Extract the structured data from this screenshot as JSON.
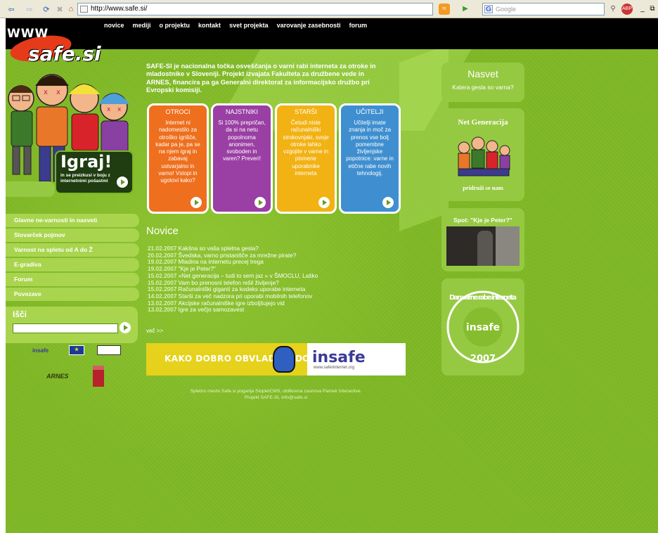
{
  "browser": {
    "url": "http://www.safe.si/",
    "search_placeholder": "Google",
    "search_engine_icon": "G"
  },
  "logo": {
    "www": "WWW",
    "safe": "safe.si"
  },
  "topnav": [
    "novice",
    "mediji",
    "o projektu",
    "kontakt",
    "svet projekta",
    "varovanje zasebnosti",
    "forum"
  ],
  "intro": "SAFE-SI je nacionalna točka osveščanja o varni rabi interneta za otroke in mladostnike v Sloveniji. Projekt izvajata Fakulteta za družbene vede in ARNES, financira pa ga Generalni direktorat za informacijsko družbo pri Evropski komisiji.",
  "cards": [
    {
      "title": "OTROCI",
      "text": "Internet ni nadomestilo za otroško igrišče, kadar pa je, pa se na njem igraj in zabavaj ustvarjalno in varno! Vstopi in ugotovi kako?",
      "color": "#ee6f1d"
    },
    {
      "title": "NAJSTNIKI",
      "text": "Si 100% prepričan, da si na netu popolnoma anonimen, svoboden in varen? Preveri!",
      "color": "#9a3fa3"
    },
    {
      "title": "STARŠI",
      "text": "Četudi niste računalniški strokovnjaki, svoje otroke lahko vzgojite v varne in pismene uporabnike interneta",
      "color": "#f2b214"
    },
    {
      "title": "UČITELJI",
      "text": "Učitelji imate znanja in moč za prenos vse bolj pomembne življenjske popotnice: varne in etične rabe novih tehnologij.",
      "color": "#3f8fd0"
    }
  ],
  "igraj": {
    "title": "Igraj!",
    "subtitle": "in se preizkusi v boju z internetnimi pošastmi"
  },
  "sidebar_menu": [
    "Glavne ne-varnosti in nasveti",
    "Slovarček pojmov",
    "Varnost na spletu od A do Ž",
    "E-gradiva",
    "Forum",
    "Povezave"
  ],
  "search": {
    "label": "Išči",
    "value": ""
  },
  "partners": {
    "insafe": "insafe",
    "eu": "EU",
    "arnes": "ARNES"
  },
  "news": {
    "title": "Novice",
    "items": [
      {
        "date": "21.02.2007",
        "title": "Kakšna so vaša spletna gesla?"
      },
      {
        "date": "20.02.2007",
        "title": "Švedska, varno pristanišče za mrežne pirate?"
      },
      {
        "date": "19.02.2007",
        "title": "Mladina na internetu precej trega"
      },
      {
        "date": "19.02.2007",
        "title": "\"Kje je Peter?\""
      },
      {
        "date": "15.02.2007",
        "title": "»Net generacija – tudi to sem jaz « v ŠMOCLU, Laško"
      },
      {
        "date": "15.02.2007",
        "title": "Vam bo prenosni telefon rešil življenje?"
      },
      {
        "date": "15.02.2007",
        "title": "Računalniški giganti za kodeks uporabe interneta"
      },
      {
        "date": "14.02.2007",
        "title": "Starši za več nadzora pri uporabi mobilnih telefonov"
      },
      {
        "date": "13.02.2007",
        "title": "Akcijske računalniške igre izboljšujejo vid"
      },
      {
        "date": "13.02.2007",
        "title": "Igre za večjo samozavest"
      }
    ],
    "more": "več >>"
  },
  "banner": {
    "text": "KAKO DOBRO OBVLADA",
    "suffix": "DO",
    "brand": "insafe",
    "url": "www.saferinternet.org"
  },
  "footer": {
    "line1": "Spletno mesto Safe.si poganja SiopletCMS, oblikovna zasnova Pamek Interactive.",
    "line2": "Projekt SAFE-SI, info@safe.si"
  },
  "right": {
    "nasvet_title": "Nasvet",
    "nasvet_sub": "Katera gesla so varna?",
    "netgen_title": "Net Generacija",
    "netgen_sub": "pridruži se nam",
    "spot_title": "Spot: \"Kje je Peter?\"",
    "dan_top": "Dan varne rabe interneta",
    "dan_year": "2007",
    "dan_brand": "insafe"
  }
}
